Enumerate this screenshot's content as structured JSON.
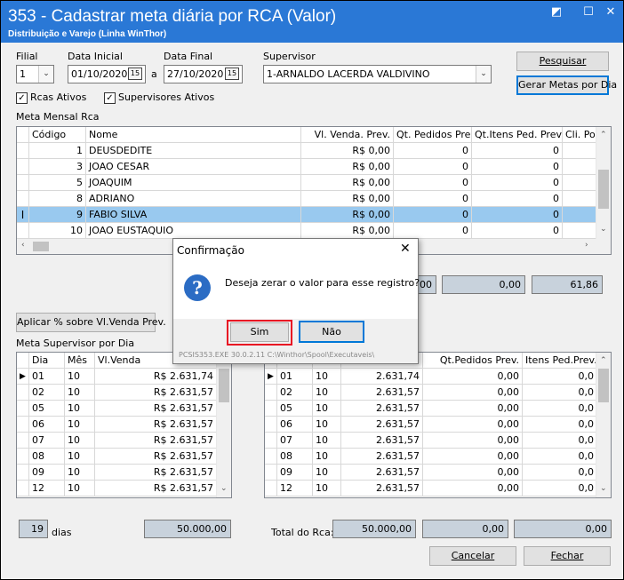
{
  "window": {
    "title": "353 - Cadastrar meta diária por RCA (Valor)",
    "subtitle": "Distribuição e Varejo (Linha WinThor)",
    "controls": [
      "◩",
      "☐",
      "✕"
    ]
  },
  "filters": {
    "filial_label": "Filial",
    "filial_value": "1",
    "data_inicial_label": "Data Inicial",
    "data_inicial_value": "01/10/2020",
    "a_label": "a",
    "data_final_label": "Data Final",
    "data_final_value": "27/10/2020",
    "calendar_glyph": "15",
    "supervisor_label": "Supervisor",
    "supervisor_value": "1-ARNALDO LACERDA VALDIVINO",
    "rcas_ativos_label": "Rcas Ativos",
    "supervisores_ativos_label": "Supervisores Ativos",
    "pesquisar_label": "Pesquisar",
    "gerar_metas_label": "Gerar Metas por Dia"
  },
  "meta_mensal": {
    "section_label": "Meta Mensal Rca",
    "columns": [
      "Código",
      "Nome",
      "Vl. Venda. Prev.",
      "Qt. Pedidos Prev.",
      "Qt.Itens Ped. Prev.",
      "Cli. Pos"
    ],
    "rows": [
      {
        "codigo": "1",
        "nome": "DEUSDEDITE",
        "vl": "R$ 0,00",
        "qtp": "0",
        "qti": "0"
      },
      {
        "codigo": "3",
        "nome": "JOAO CESAR",
        "vl": "R$ 0,00",
        "qtp": "0",
        "qti": "0"
      },
      {
        "codigo": "5",
        "nome": "JOAQUIM",
        "vl": "R$ 0,00",
        "qtp": "0",
        "qti": "0"
      },
      {
        "codigo": "8",
        "nome": "ADRIANO",
        "vl": "R$ 0,00",
        "qtp": "0",
        "qti": "0"
      },
      {
        "codigo": "9",
        "nome": "FABIO SILVA",
        "vl": "R$ 0,00",
        "qtp": "0",
        "qti": "0"
      },
      {
        "codigo": "10",
        "nome": "JOAO EUSTAQUIO",
        "vl": "R$ 0,00",
        "qtp": "0",
        "qti": "0"
      }
    ],
    "selected_index": 4,
    "totals": [
      ",00",
      "0,00",
      "61,86"
    ]
  },
  "aplicar_label": "Aplicar % sobre Vl.Venda Prev.",
  "meta_supervisor": {
    "section_label": "Meta Supervisor por Dia",
    "columns": [
      "Dia",
      "Mês",
      "Vl.Venda"
    ],
    "rows": [
      {
        "dia": "01",
        "mes": "10",
        "vl": "R$ 2.631,74"
      },
      {
        "dia": "02",
        "mes": "10",
        "vl": "R$ 2.631,57"
      },
      {
        "dia": "05",
        "mes": "10",
        "vl": "R$ 2.631,57"
      },
      {
        "dia": "06",
        "mes": "10",
        "vl": "R$ 2.631,57"
      },
      {
        "dia": "07",
        "mes": "10",
        "vl": "R$ 2.631,57"
      },
      {
        "dia": "08",
        "mes": "10",
        "vl": "R$ 2.631,57"
      },
      {
        "dia": "09",
        "mes": "10",
        "vl": "R$ 2.631,57"
      },
      {
        "dia": "12",
        "mes": "10",
        "vl": "R$ 2.631,57"
      }
    ],
    "dias_value": "19",
    "dias_label": "dias",
    "total_value": "50.000,00"
  },
  "meta_rca_dia": {
    "columns": [
      "",
      "",
      "",
      "Qt.Pedidos Prev.",
      "Itens Ped.Prev."
    ],
    "rows": [
      {
        "dia": "01",
        "mes": "10",
        "vl": "2.631,74",
        "qtp": "0,00",
        "qti": "0,0"
      },
      {
        "dia": "02",
        "mes": "10",
        "vl": "2.631,57",
        "qtp": "0,00",
        "qti": "0,0"
      },
      {
        "dia": "05",
        "mes": "10",
        "vl": "2.631,57",
        "qtp": "0,00",
        "qti": "0,0"
      },
      {
        "dia": "06",
        "mes": "10",
        "vl": "2.631,57",
        "qtp": "0,00",
        "qti": "0,0"
      },
      {
        "dia": "07",
        "mes": "10",
        "vl": "2.631,57",
        "qtp": "0,00",
        "qti": "0,0"
      },
      {
        "dia": "08",
        "mes": "10",
        "vl": "2.631,57",
        "qtp": "0,00",
        "qti": "0,0"
      },
      {
        "dia": "09",
        "mes": "10",
        "vl": "2.631,57",
        "qtp": "0,00",
        "qti": "0,0"
      },
      {
        "dia": "12",
        "mes": "10",
        "vl": "2.631,57",
        "qtp": "0,00",
        "qti": "0,0"
      }
    ],
    "total_label": "Total do Rca:",
    "totals": [
      "50.000,00",
      "0,00",
      "0,00"
    ]
  },
  "footer": {
    "cancelar_label": "Cancelar",
    "fechar_label": "Fechar"
  },
  "dialog": {
    "title": "Confirmação",
    "message": "Deseja zerar o valor para esse registro?",
    "sim_label": "Sim",
    "nao_label": "Não",
    "status": "PCSIS353.EXE 30.0.2.11 C:\\Winthor\\Spool\\Executaveis\\"
  },
  "colors": {
    "titlebar": "#2a78d6",
    "selection": "#99c9ef",
    "highlight": "#e81123"
  }
}
